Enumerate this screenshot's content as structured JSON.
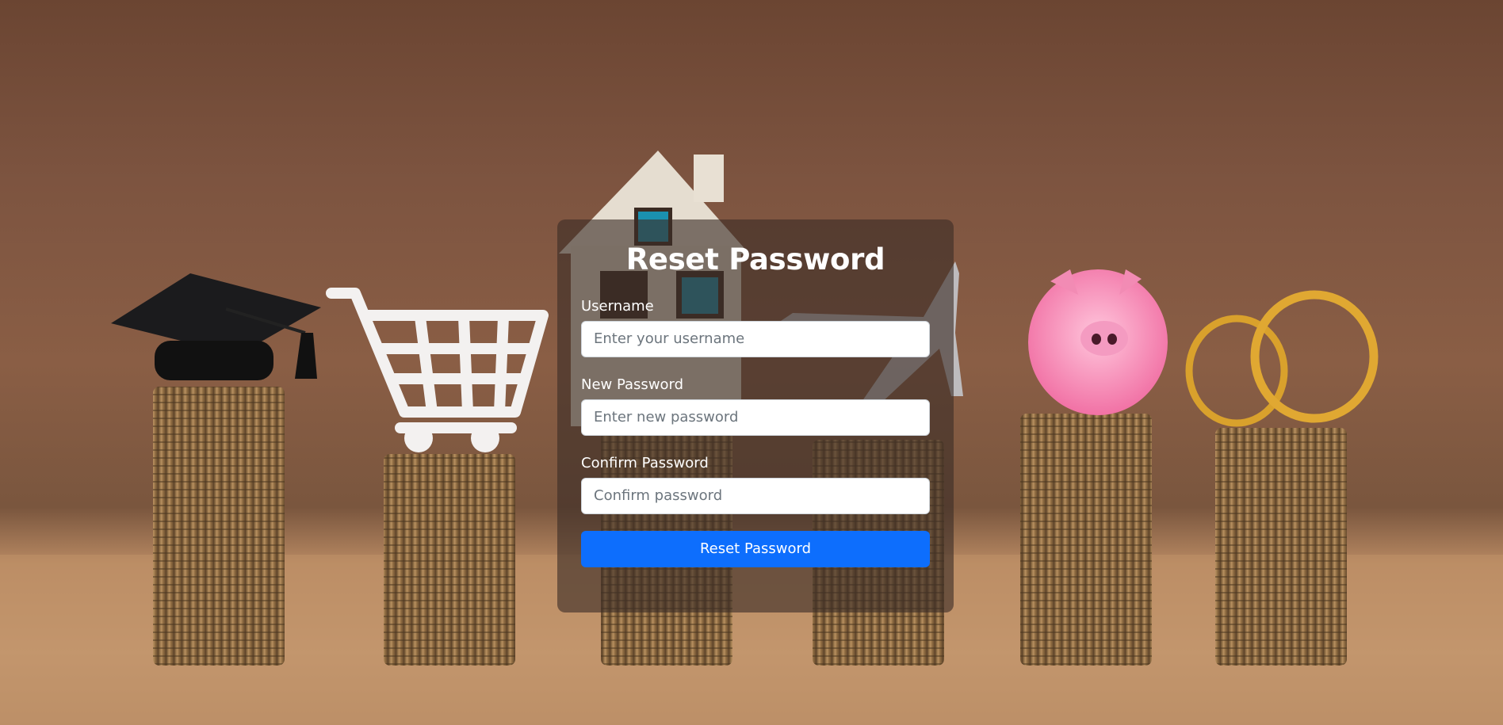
{
  "page": {
    "title": "Reset Password"
  },
  "form": {
    "username": {
      "label": "Username",
      "placeholder": "Enter your username"
    },
    "new_password": {
      "label": "New Password",
      "placeholder": "Enter new password"
    },
    "confirm_password": {
      "label": "Confirm Password",
      "placeholder": "Confirm password"
    },
    "submit_label": "Reset Password"
  },
  "colors": {
    "primary_button": "#0d6efd",
    "card_overlay": "rgba(60,45,38,0.62)",
    "text": "#ffffff"
  },
  "background": {
    "image_subject": "coin-stacks-with-graduation-cap-cart-house-plane-piggy-bank-rings"
  }
}
